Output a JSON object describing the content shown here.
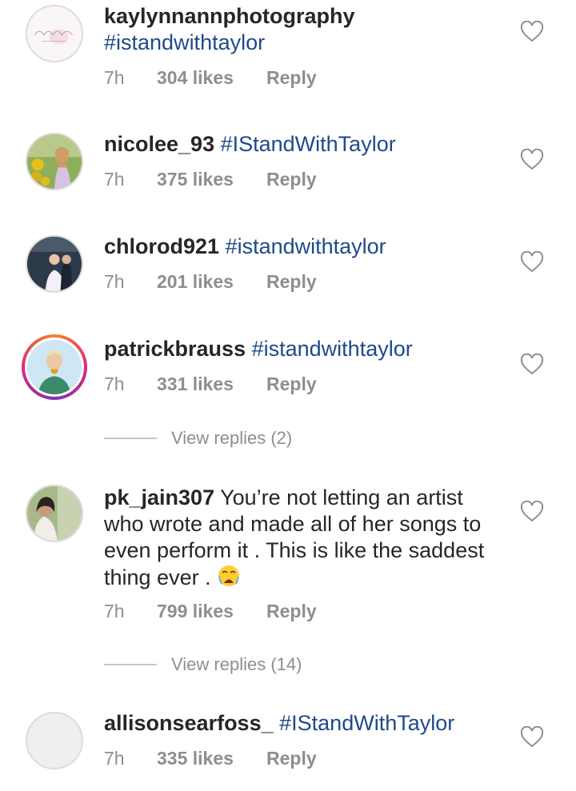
{
  "comments": [
    {
      "username": "kaylynnannphotography",
      "text": "#istandwithtaylor",
      "time": "7h",
      "likes": "304 likes",
      "reply": "Reply",
      "avatar": "logo-avatar"
    },
    {
      "username": "nicolee_93",
      "text": "#IStandWithTaylor",
      "time": "7h",
      "likes": "375 likes",
      "reply": "Reply",
      "avatar": "photo-avatar"
    },
    {
      "username": "chlorod921",
      "text": "#istandwithtaylor",
      "time": "7h",
      "likes": "201 likes",
      "reply": "Reply",
      "avatar": "photo-avatar"
    },
    {
      "username": "patrickbrauss",
      "text": "#istandwithtaylor",
      "time": "7h",
      "likes": "331 likes",
      "reply": "Reply",
      "avatar": "story-ring-avatar",
      "view_replies": "View replies (2)"
    },
    {
      "username": "pk_jain307",
      "text_lines": [
        "You’re not letting an artist",
        "who wrote and made all of her songs to",
        "even perform it . This is like the saddest",
        "thing ever ."
      ],
      "emoji": "crying-face-emoji",
      "time": "7h",
      "likes": "799 likes",
      "reply": "Reply",
      "avatar": "photo-avatar",
      "view_replies": "View replies (14)"
    },
    {
      "username": "allisonsearfoss_",
      "text": "#IStandWithTaylor",
      "time": "7h",
      "likes": "335 likes",
      "reply": "Reply",
      "avatar": "default-avatar"
    }
  ],
  "icons": {
    "like": "heart-outline-icon"
  },
  "colors": {
    "hashtag": "#1e4a8a",
    "meta": "#8e8e8e",
    "story_ring": "#dd2a7b"
  }
}
